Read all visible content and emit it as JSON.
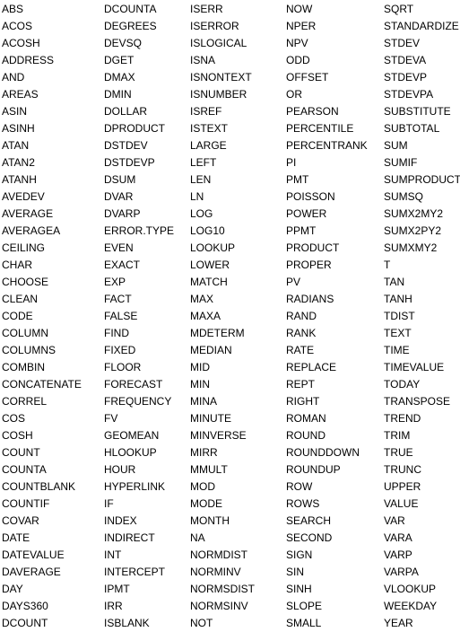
{
  "columns": [
    [
      "ABS",
      "ACOS",
      "ACOSH",
      "ADDRESS",
      "AND",
      "AREAS",
      "ASIN",
      "ASINH",
      "ATAN",
      "ATAN2",
      "ATANH",
      "AVEDEV",
      "AVERAGE",
      "AVERAGEA",
      "CEILING",
      "CHAR",
      "CHOOSE",
      "CLEAN",
      "CODE",
      "COLUMN",
      "COLUMNS",
      "COMBIN",
      "CONCATENATE",
      "CORREL",
      "COS",
      "COSH",
      "COUNT",
      "COUNTA",
      "COUNTBLANK",
      "COUNTIF",
      "COVAR",
      "DATE",
      "DATEVALUE",
      "DAVERAGE",
      "DAY",
      "DAYS360",
      "DCOUNT"
    ],
    [
      "DCOUNTA",
      "DEGREES",
      "DEVSQ",
      "DGET",
      "DMAX",
      "DMIN",
      "DOLLAR",
      "DPRODUCT",
      "DSTDEV",
      "DSTDEVP",
      "DSUM",
      "DVAR",
      "DVARP",
      "ERROR.TYPE",
      "EVEN",
      "EXACT",
      "EXP",
      "FACT",
      "FALSE",
      "FIND",
      "FIXED",
      "FLOOR",
      "FORECAST",
      "FREQUENCY",
      "FV",
      "GEOMEAN",
      "HLOOKUP",
      "HOUR",
      "HYPERLINK",
      "IF",
      "INDEX",
      "INDIRECT",
      "INT",
      "INTERCEPT",
      "IPMT",
      "IRR",
      "ISBLANK"
    ],
    [
      "ISERR",
      "ISERROR",
      "ISLOGICAL",
      "ISNA",
      "ISNONTEXT",
      "ISNUMBER",
      "ISREF",
      "ISTEXT",
      "LARGE",
      "LEFT",
      "LEN",
      "LN",
      "LOG",
      "LOG10",
      "LOOKUP",
      "LOWER",
      "MATCH",
      "MAX",
      "MAXA",
      "MDETERM",
      "MEDIAN",
      "MID",
      "MIN",
      "MINA",
      "MINUTE",
      "MINVERSE",
      "MIRR",
      "MMULT",
      "MOD",
      "MODE",
      "MONTH",
      "NA",
      "NORMDIST",
      "NORMINV",
      "NORMSDIST",
      "NORMSINV",
      "NOT"
    ],
    [
      "NOW",
      "NPER",
      "NPV",
      "ODD",
      "OFFSET",
      "OR",
      "PEARSON",
      "PERCENTILE",
      "PERCENTRANK",
      "PI",
      "PMT",
      "POISSON",
      "POWER",
      "PPMT",
      "PRODUCT",
      "PROPER",
      "PV",
      "RADIANS",
      "RAND",
      "RANK",
      "RATE",
      "REPLACE",
      "REPT",
      "RIGHT",
      "ROMAN",
      "ROUND",
      "ROUNDDOWN",
      "ROUNDUP",
      "ROW",
      "ROWS",
      "SEARCH",
      "SECOND",
      "SIGN",
      "SIN",
      "SINH",
      "SLOPE",
      "SMALL"
    ],
    [
      "SQRT",
      "STANDARDIZE",
      "STDEV",
      "STDEVA",
      "STDEVP",
      "STDEVPA",
      "SUBSTITUTE",
      "SUBTOTAL",
      "SUM",
      "SUMIF",
      "SUMPRODUCT",
      "SUMSQ",
      "SUMX2MY2",
      "SUMX2PY2",
      "SUMXMY2",
      "T",
      "TAN",
      "TANH",
      "TDIST",
      "TEXT",
      "TIME",
      "TIMEVALUE",
      "TODAY",
      "TRANSPOSE",
      "TREND",
      "TRIM",
      "TRUE",
      "TRUNC",
      "UPPER",
      "VALUE",
      "VAR",
      "VARA",
      "VARP",
      "VARPA",
      "VLOOKUP",
      "WEEKDAY",
      "YEAR"
    ]
  ]
}
